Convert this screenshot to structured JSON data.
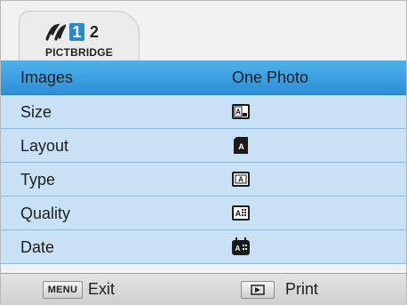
{
  "header": {
    "mode_label": "PICTBRIDGE",
    "step_one": "1",
    "step_two": "2"
  },
  "menu": [
    {
      "label": "Images",
      "value": "One Photo",
      "selected": true
    },
    {
      "label": "Size",
      "icon": "size-icon"
    },
    {
      "label": "Layout",
      "icon": "layout-icon"
    },
    {
      "label": "Type",
      "icon": "type-icon"
    },
    {
      "label": "Quality",
      "icon": "quality-icon"
    },
    {
      "label": "Date",
      "icon": "date-icon"
    }
  ],
  "bottom_bar": {
    "menu_key": "MENU",
    "exit_label": "Exit",
    "play_icon": "play-icon",
    "print_label": "Print"
  },
  "colors": {
    "selected_row": "#2d8fd6",
    "menu_row": "#c9e1f4",
    "accent_tab": "#2b88c9"
  }
}
